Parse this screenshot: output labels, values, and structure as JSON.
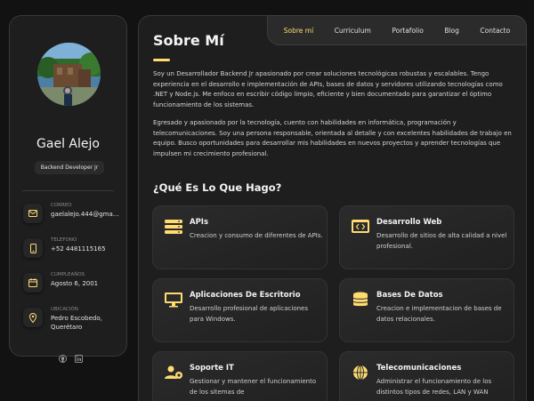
{
  "profile": {
    "name": "Gael Alejo",
    "role": "Backend Developer Jr"
  },
  "contacts": [
    {
      "label": "CORREO",
      "value": "gaelalejo.444@gma...",
      "icon": "mail-icon"
    },
    {
      "label": "TELEFONO",
      "value": "+52 4481115165",
      "icon": "phone-icon"
    },
    {
      "label": "CUMPLEAÑOS",
      "value": "Agosto 6, 2001",
      "icon": "calendar-icon"
    },
    {
      "label": "UBICACIÓN",
      "value": "Pedro Escobedo,",
      "value2": "Querétaro",
      "icon": "location-pin-icon"
    }
  ],
  "social": [
    "github-icon",
    "linkedin-icon"
  ],
  "nav": [
    "Sobre mí",
    "Curriculum",
    "Portafolio",
    "Blog",
    "Contacto"
  ],
  "nav_active": "Sobre mí",
  "about": {
    "title": "Sobre Mí",
    "p1": "Soy un Desarrollador Backend Jr apasionado por crear soluciones tecnológicas robustas y escalables. Tengo experiencia en el desarrollo e implementación de APIs, bases de datos y servidores utilizando tecnologías como .NET y Node.js. Me enfoco en escribir código limpio, eficiente y bien documentado para garantizar el óptimo funcionamiento de los sistemas.",
    "p2": "Egresado y apasionado por la tecnología, cuento con habilidades en informática, programación y telecomunicaciones. Soy una persona responsable, orientada al detalle y con excelentes habilidades de trabajo en equipo. Busco oportunidades para desarrollar mis habilidades en nuevos proyectos y aprender tecnologías que impulsen mi crecimiento profesional."
  },
  "services": {
    "title": "¿Qué Es Lo Que Hago?",
    "items": [
      {
        "title": "APIs",
        "text": "Creacion y consumo de diferentes de APIs.",
        "icon": "stack-icon"
      },
      {
        "title": "Desarrollo Web",
        "text": "Desarrollo de sitios de alta calidad a nivel profesional.",
        "icon": "code-window-icon"
      },
      {
        "title": "Aplicaciones De Escritorio",
        "text": "Desarrollo profesional de aplicaciones para Windows.",
        "icon": "monitor-icon"
      },
      {
        "title": "Bases De Datos",
        "text": "Creacion e implementacion de bases de datos relacionales.",
        "icon": "database-icon"
      },
      {
        "title": "Soporte IT",
        "text": "Gestionar y mantener el funcionamiento de los sitemas de",
        "icon": "users-gear-icon"
      },
      {
        "title": "Telecomunicaciones",
        "text": "Administrar el funcionamiento de los distintos tipos de redes, LAN y WAN",
        "icon": "globe-icon"
      }
    ]
  },
  "colors": {
    "accent": "#ffdb70",
    "background": "#121212",
    "panel": "#1e1e1f"
  }
}
